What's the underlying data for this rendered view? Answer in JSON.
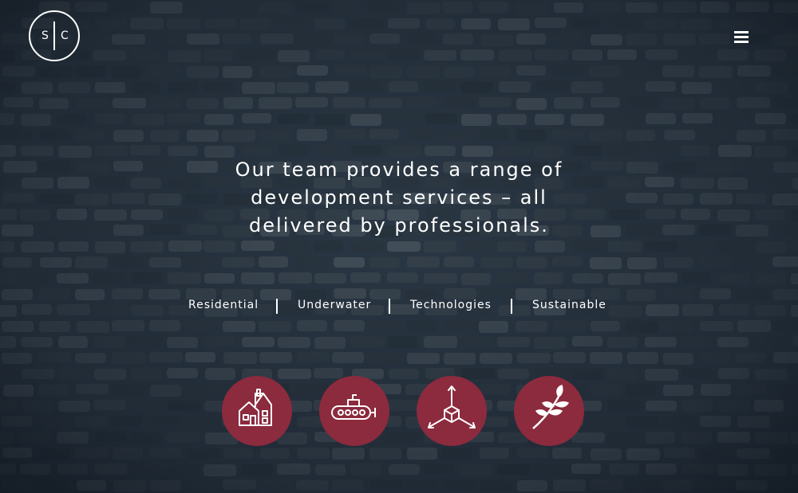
{
  "logo": {
    "left_letter": "S",
    "right_letter": "C"
  },
  "menu": {
    "icon": "hamburger-menu-icon"
  },
  "hero": {
    "headline_lines": [
      "Our team provides a range of",
      "development services – all",
      "delivered by professionals."
    ]
  },
  "services": [
    {
      "label": "Residential",
      "icon": "house-icon"
    },
    {
      "label": "Underwater",
      "icon": "submarine-icon"
    },
    {
      "label": "Technologies",
      "icon": "cube-arrows-icon"
    },
    {
      "label": "Sustainable",
      "icon": "leaf-branch-icon"
    }
  ],
  "colors": {
    "background": "#2a3744",
    "icon_circle": "#8c2a3e",
    "text": "#ffffff"
  }
}
